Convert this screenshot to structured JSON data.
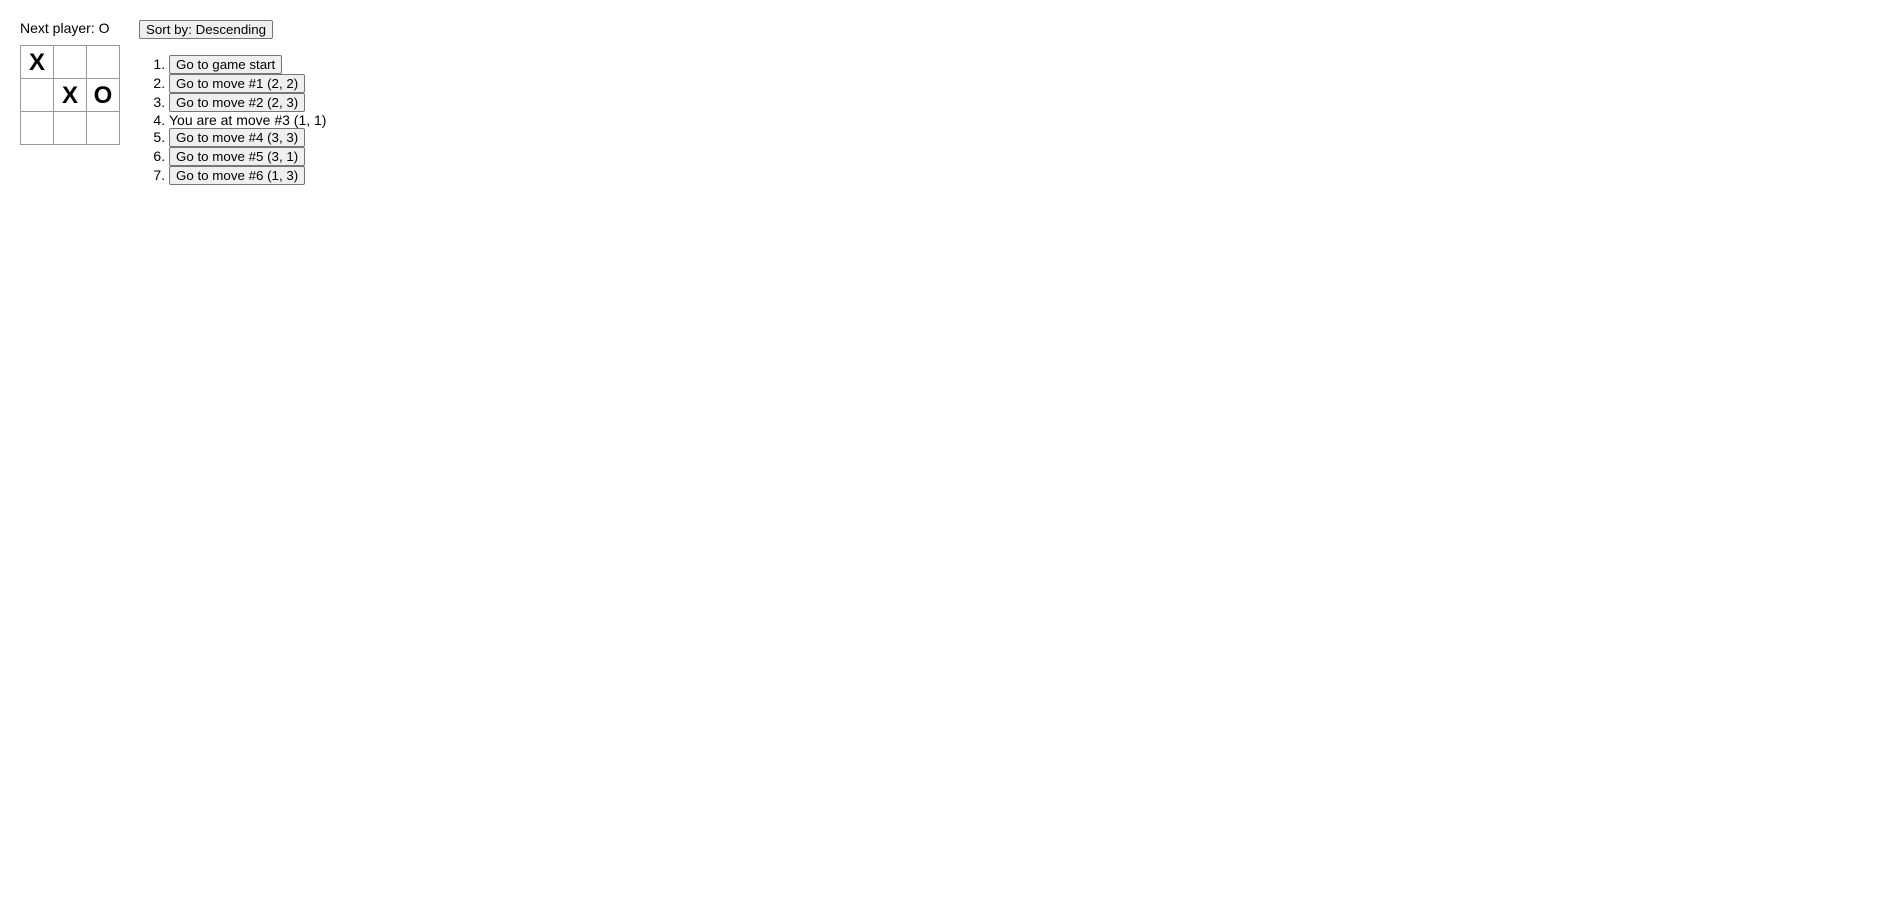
{
  "status": "Next player: O",
  "board": {
    "rows": [
      [
        "X",
        "",
        ""
      ],
      [
        "",
        "X",
        "O"
      ],
      [
        "",
        "",
        ""
      ]
    ]
  },
  "sort_button_label": "Sort by: Descending",
  "moves": [
    {
      "label": "Go to game start",
      "is_current": false
    },
    {
      "label": "Go to move #1 (2, 2)",
      "is_current": false
    },
    {
      "label": "Go to move #2 (2, 3)",
      "is_current": false
    },
    {
      "label": "You are at move #3 (1, 1)",
      "is_current": true
    },
    {
      "label": "Go to move #4 (3, 3)",
      "is_current": false
    },
    {
      "label": "Go to move #5 (3, 1)",
      "is_current": false
    },
    {
      "label": "Go to move #6 (1, 3)",
      "is_current": false
    }
  ]
}
